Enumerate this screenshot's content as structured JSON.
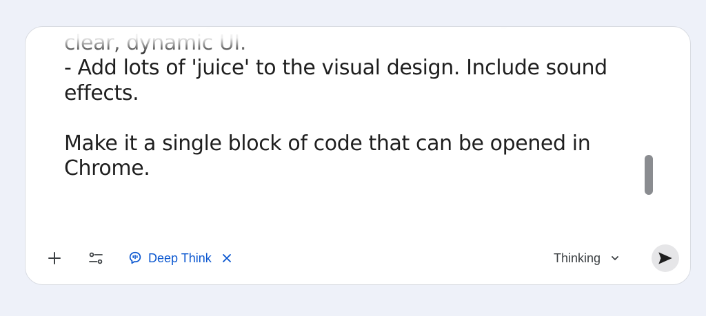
{
  "prompt": {
    "text": "- The visual style should be colorful and bright, with\nclear, dynamic UI.\n- Add lots of 'juice' to the visual design. Include sound\neffects.\n\nMake it a single block of code that can be opened in\nChrome."
  },
  "toolbar": {
    "add_icon": "plus-icon",
    "tools_icon": "tools-sliders-icon",
    "deep_think": {
      "icon": "deep-think-icon",
      "label": "Deep Think",
      "close_icon": "close-icon"
    },
    "model_selector": {
      "label": "Thinking",
      "icon": "chevron-down-icon"
    },
    "send_icon": "send-icon"
  },
  "colors": {
    "background": "#eef1f9",
    "card": "#ffffff",
    "text": "#1f1f1f",
    "accent": "#0b57d0",
    "scrollbar": "#8a8c90",
    "send_button_bg": "#e6e6e8"
  }
}
